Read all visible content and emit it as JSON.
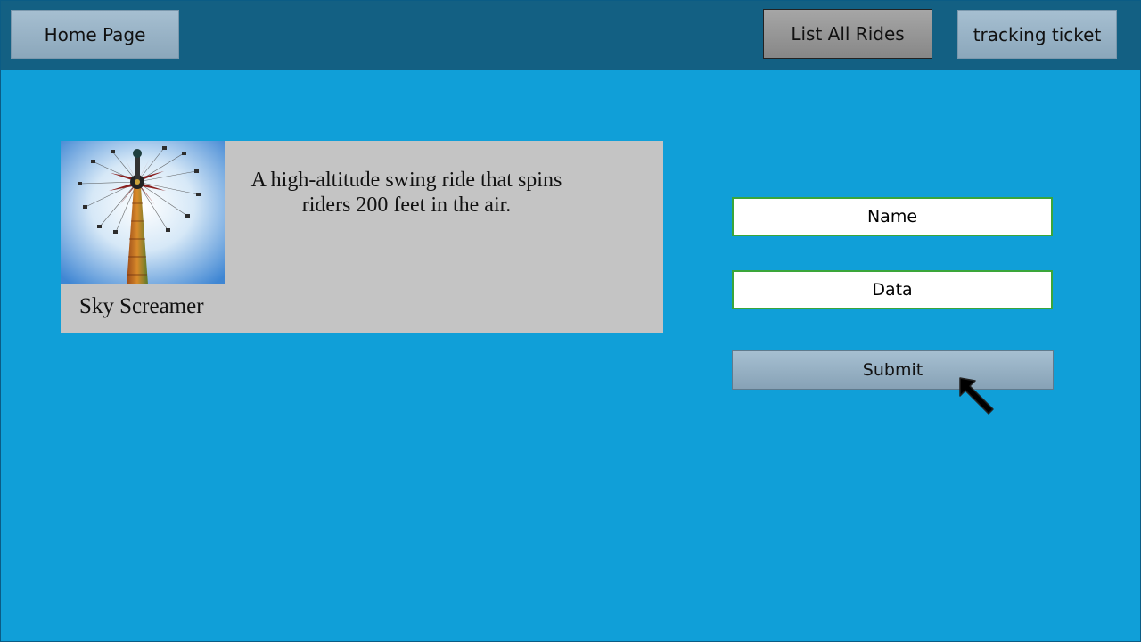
{
  "nav": {
    "home_label": "Home Page",
    "list_rides_label": "List All Rides",
    "tracking_label": "tracking ticket"
  },
  "ride": {
    "name": "Sky Screamer",
    "description": "A high-altitude swing ride that spins riders 200 feet in the air."
  },
  "form": {
    "name_placeholder": "Name",
    "data_placeholder": "Data",
    "submit_label": "Submit"
  },
  "colors": {
    "page_background": "#109fd8",
    "topbar_background": "#136083",
    "card_background": "#c4c4c4",
    "field_border": "#3aa63a"
  }
}
